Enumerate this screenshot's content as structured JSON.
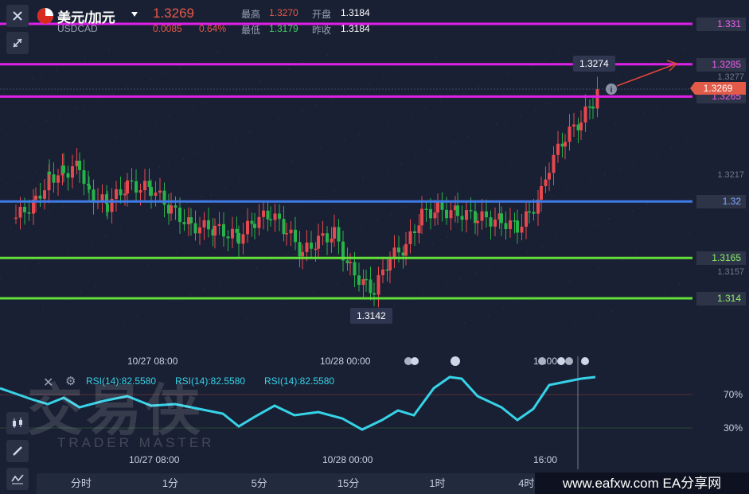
{
  "header": {
    "pair_name": "美元/加元",
    "symbol": "USDCAD",
    "price": "1.3269",
    "change": "0.0085",
    "change_pct": "0.64%",
    "high_label": "最高",
    "high_value": "1.3270",
    "low_label": "最低",
    "low_value": "1.3179",
    "open_label": "开盘",
    "open_value": "1.3184",
    "prev_label": "昨收",
    "prev_value": "1.3184"
  },
  "levels": [
    {
      "label": "1.331",
      "color": "#e020e8",
      "y": 1.331
    },
    {
      "label": "1.3285",
      "color": "#e020e8",
      "y": 1.3285
    },
    {
      "label": "1.3265",
      "color": "#e020e8",
      "y": 1.3265
    },
    {
      "label": "1.32",
      "color": "#3f7be8",
      "y": 1.32
    },
    {
      "label": "1.3165",
      "color": "#62e03a",
      "y": 1.3165
    },
    {
      "label": "1.314",
      "color": "#62e03a",
      "y": 1.314
    }
  ],
  "axis_prices": [
    "1.3277",
    "1.3217",
    "1.3157"
  ],
  "current_price_tag": "1.3269",
  "high_marker": "1.3274",
  "low_marker": "1.3142",
  "time_labels": [
    "10/27 08:00",
    "10/28 00:00",
    "16:00"
  ],
  "rsi": {
    "labels": [
      "RSI(14):82.5580",
      "RSI(14):82.5580",
      "RSI(14):82.5580"
    ],
    "levels": [
      "70%",
      "30%"
    ],
    "time_labels": [
      "10/27 08:00",
      "10/28 00:00",
      "16:00"
    ]
  },
  "tabs": [
    "分时",
    "1分",
    "5分",
    "15分",
    "1时",
    "4时"
  ],
  "watermark": {
    "brand": "交易侠",
    "brand_sub": "TRADER MASTER",
    "footer": "www.eafxw.com   EA分享网"
  },
  "colors": {
    "up": "#e5484d",
    "down": "#27b24a",
    "accent": "#e0463a",
    "rsi_line": "#36d3e8"
  }
}
